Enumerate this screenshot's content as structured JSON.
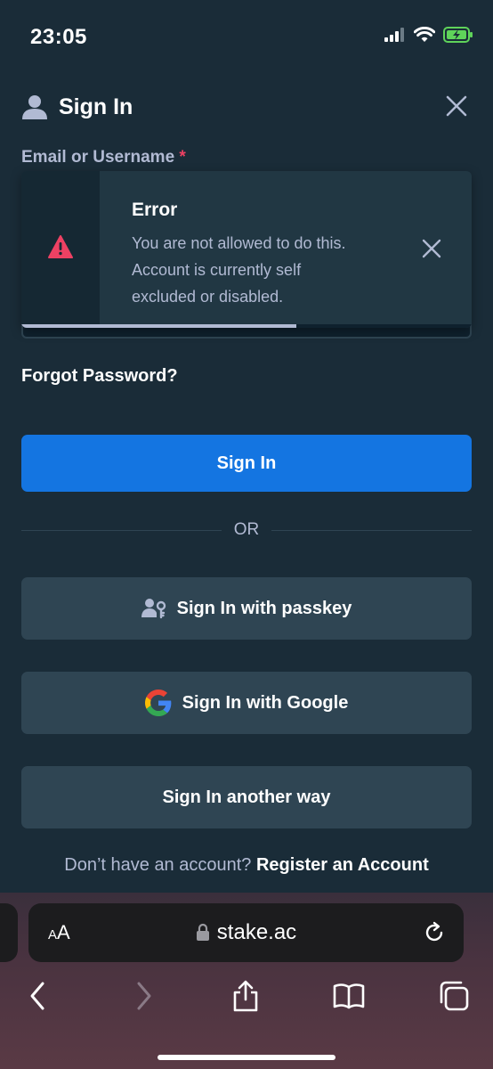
{
  "status": {
    "time": "23:05"
  },
  "header": {
    "title": "Sign In"
  },
  "form": {
    "email_label": "Email or Username",
    "required_mark": "*",
    "forgot_password": "Forgot Password?",
    "sign_in": "Sign In",
    "divider": "OR",
    "passkey": "Sign In with passkey",
    "google": "Sign In with Google",
    "another_way": "Sign In another way",
    "register_question": "Don’t have an account?",
    "register_link": "Register an Account"
  },
  "toast": {
    "title": "Error",
    "message": "You are not allowed to do this. Account is currently self excluded or disabled.",
    "progress_fraction": 0.61
  },
  "browser": {
    "text_size": "AA",
    "url": "stake.ac"
  },
  "colors": {
    "background": "#1a2c38",
    "primary": "#1475e1",
    "secondary": "#2f4553",
    "error": "#ed4163"
  }
}
